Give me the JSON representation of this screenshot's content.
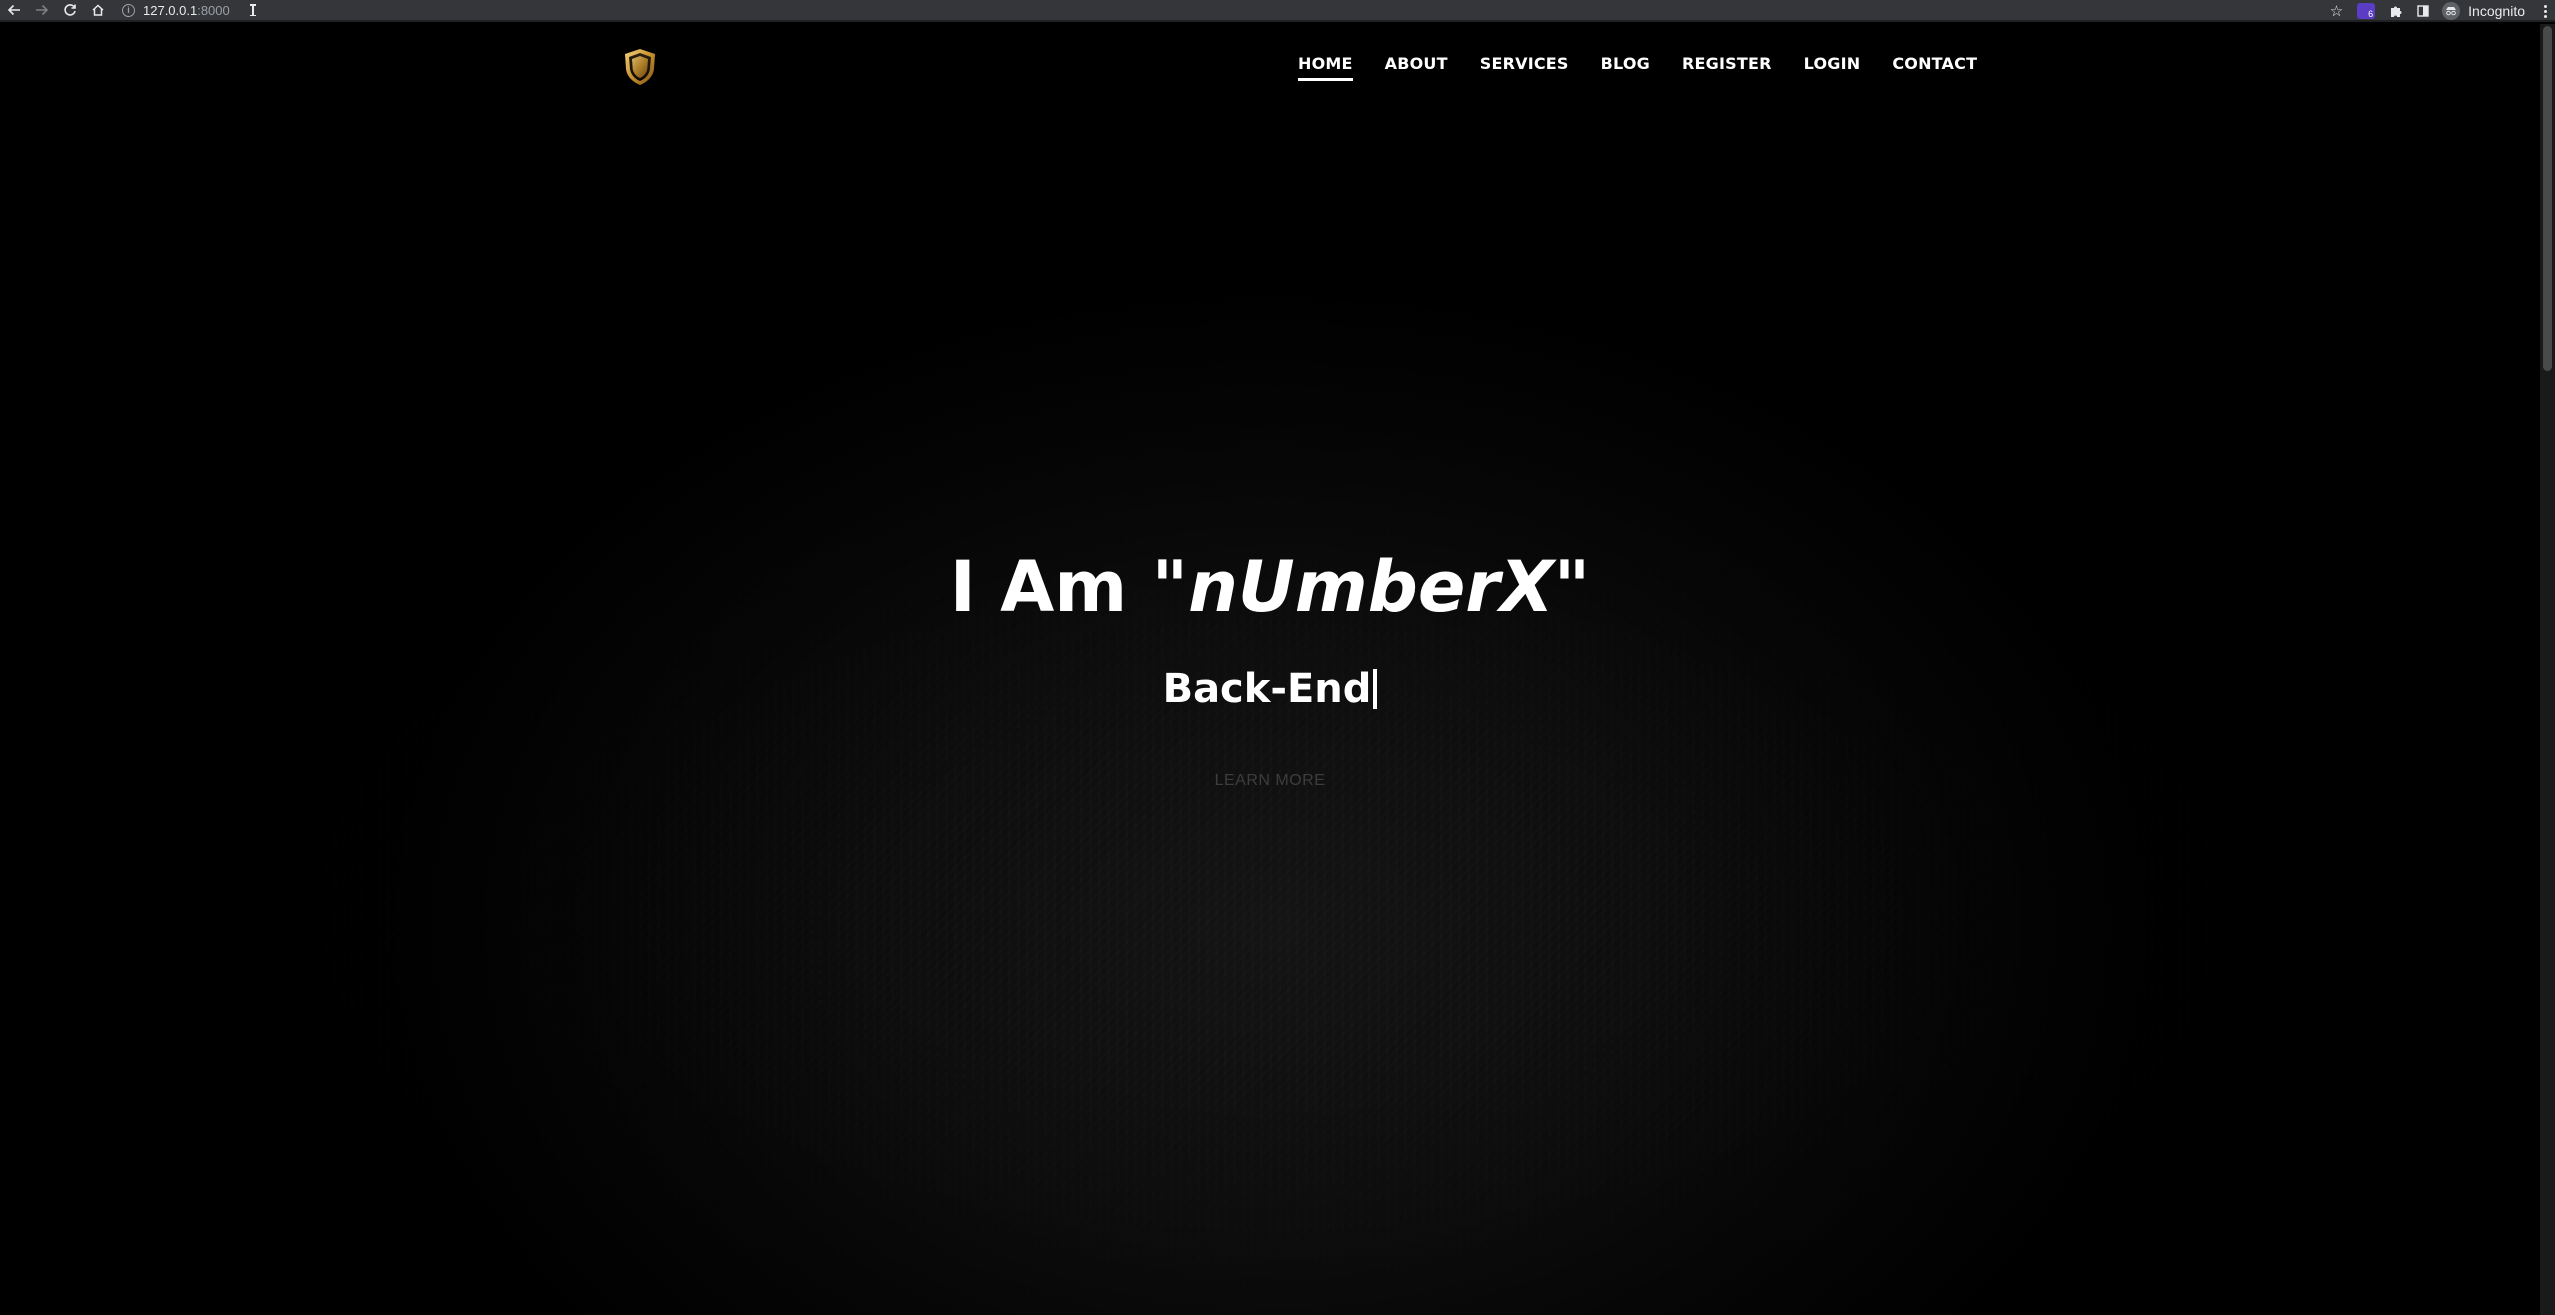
{
  "browser": {
    "url_host": "127.0.0.1",
    "url_port": ":8000",
    "profile_label": "Incognito",
    "extension_badge": "6"
  },
  "nav": {
    "items": [
      {
        "label": "HOME",
        "active": true
      },
      {
        "label": "ABOUT"
      },
      {
        "label": "SERVICES"
      },
      {
        "label": "BLOG"
      },
      {
        "label": "REGISTER"
      },
      {
        "label": "LOGIN"
      },
      {
        "label": "CONTACT"
      }
    ]
  },
  "hero": {
    "title_prefix": "I Am ",
    "title_name": "\"nUmberX\"",
    "subtitle": "Back-End",
    "cta_label": "LEARN MORE"
  },
  "colors": {
    "background": "#000000",
    "text": "#ffffff",
    "cta": "#3d3d3d",
    "logo_gold": "#d4a23a"
  }
}
